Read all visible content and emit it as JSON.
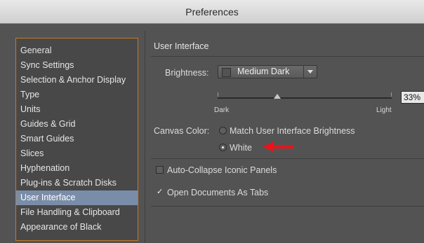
{
  "window": {
    "title": "Preferences"
  },
  "sidebar": {
    "items": [
      {
        "label": "General"
      },
      {
        "label": "Sync Settings"
      },
      {
        "label": "Selection & Anchor Display"
      },
      {
        "label": "Type"
      },
      {
        "label": "Units"
      },
      {
        "label": "Guides & Grid"
      },
      {
        "label": "Smart Guides"
      },
      {
        "label": "Slices"
      },
      {
        "label": "Hyphenation"
      },
      {
        "label": "Plug-ins & Scratch Disks"
      },
      {
        "label": "User Interface"
      },
      {
        "label": "File Handling & Clipboard"
      },
      {
        "label": "Appearance of Black"
      }
    ],
    "selected": "User Interface"
  },
  "panel": {
    "section_title": "User Interface",
    "brightness": {
      "label": "Brightness:",
      "value": "Medium Dark",
      "slider_min_label": "Dark",
      "slider_max_label": "Light",
      "slider_value": 0.33,
      "percent_text": "33%"
    },
    "canvas_color": {
      "label": "Canvas Color:",
      "options": [
        {
          "label": "Match User Interface Brightness",
          "checked": false
        },
        {
          "label": "White",
          "checked": true
        }
      ]
    },
    "checkboxes": [
      {
        "label": "Auto-Collapse Iconic Panels",
        "checked": false
      },
      {
        "label": "Open Documents As Tabs",
        "checked": true
      }
    ]
  },
  "colors": {
    "background": "#535353",
    "selection": "#7a8da8",
    "sidebar_border": "#c47a2c",
    "annotation_arrow": "#e8141b"
  }
}
